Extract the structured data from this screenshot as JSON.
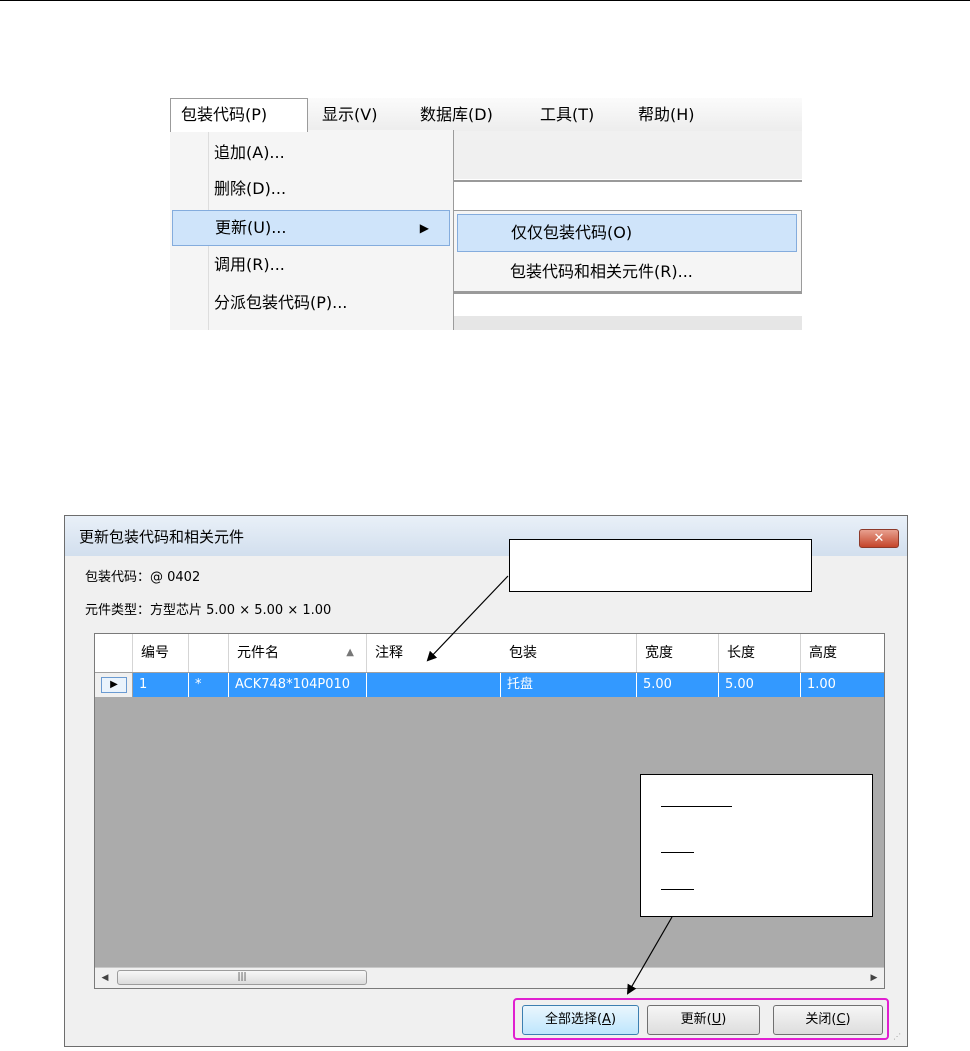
{
  "menubar": {
    "items": [
      "包装代码(P)",
      "显示(V)",
      "数据库(D)",
      "工具(T)",
      "帮助(H)"
    ]
  },
  "package_menu": {
    "items": [
      "追加(A)...",
      "删除(D)...",
      "更新(U)...",
      "调用(R)...",
      "分派包装代码(P)..."
    ],
    "selected": "更新(U)..."
  },
  "update_submenu": {
    "items": [
      "仅仅包装代码(O)",
      "包装代码和相关元件(R)..."
    ],
    "selected": "仅仅包装代码(O)"
  },
  "dialog": {
    "title": "更新包装代码和相关元件",
    "close_glyph": "✕",
    "package_code_line": "包装代码：@ 0402",
    "component_type_line": "元件类型：方型芯片  5.00 × 5.00 × 1.00",
    "grid": {
      "columns": [
        "编号",
        "",
        "元件名",
        "注释",
        "包装",
        "宽度",
        "长度",
        "高度"
      ],
      "sorted_column": "元件名",
      "rows": [
        {
          "no": "1",
          "mark": "*",
          "name": "ACK748*104P010",
          "comment": "",
          "package": "托盘",
          "width": "5.00",
          "length": "5.00",
          "height": "1.00"
        }
      ]
    },
    "buttons": {
      "select_all": {
        "text": "全部选择(",
        "key": "A",
        "end": ")"
      },
      "update": {
        "text": "更新(",
        "key": "U",
        "end": ")"
      },
      "close": {
        "text": "关闭(",
        "key": "C",
        "end": ")"
      }
    }
  },
  "colors": {
    "menu_highlight": "#cfe4fa",
    "grid_selection": "#3399ff",
    "button_frame": "#e020d0",
    "close_button": "#c4452a"
  }
}
